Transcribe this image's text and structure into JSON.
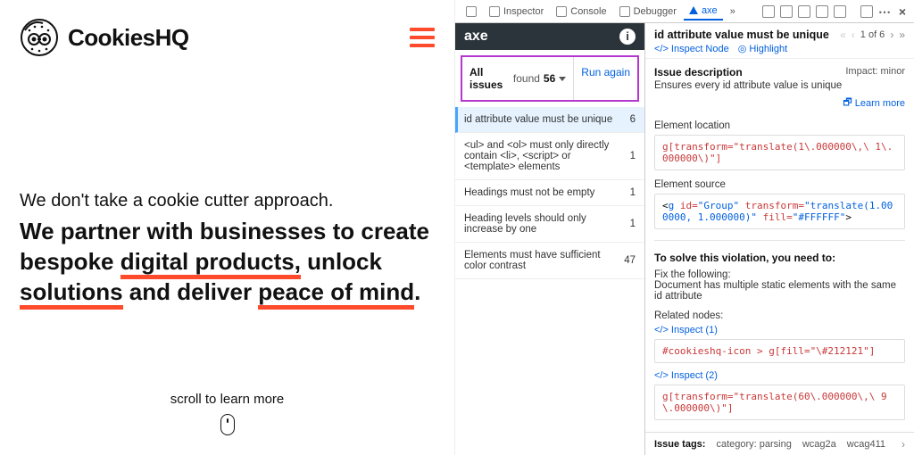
{
  "site": {
    "brand": "CookiesHQ",
    "hero_sub": "We don't take a cookie cutter approach.",
    "hero_line1_a": "We partner with businesses to create",
    "hero_line2_a": "bespoke ",
    "hero_u1": "digital products,",
    "hero_line2_b": " unlock",
    "hero_u2": "solutions",
    "hero_line3_b": " and deliver ",
    "hero_u3": "peace of mind",
    "hero_period": ".",
    "scroll": "scroll to learn more"
  },
  "devtools_tabs": {
    "inspector": "Inspector",
    "console": "Console",
    "debugger": "Debugger",
    "axe": "axe",
    "overflow": "»"
  },
  "axe": {
    "brand": "axe",
    "all_issues": "All issues",
    "found": " found ",
    "count": "56",
    "run_again": "Run again",
    "issues": [
      {
        "label": "id attribute value must be unique",
        "count": "6"
      },
      {
        "label": "<ul> and <ol> must only directly contain <li>, <script> or <template> elements",
        "count": "1"
      },
      {
        "label": "Headings must not be empty",
        "count": "1"
      },
      {
        "label": "Heading levels should only increase by one",
        "count": "1"
      },
      {
        "label": "Elements must have sufficient color contrast",
        "count": "47"
      }
    ]
  },
  "detail": {
    "title": "id attribute value must be unique",
    "inspect_node": "Inspect Node",
    "highlight": "Highlight",
    "pager": "1 of 6",
    "desc_h": "Issue description",
    "impact": "Impact: minor",
    "desc_t": "Ensures every id attribute value is unique",
    "learn": "Learn more",
    "elem_loc_h": "Element location",
    "elem_loc_code": "g[transform=\"translate(1\\.000000\\,\\ 1\\.000000\\)\"]",
    "elem_src_h": "Element source",
    "src_open": "<",
    "src_tag": "g",
    "src_attr_id": " id=",
    "src_val_id": "\"Group\"",
    "src_attr_tr": " transform=",
    "src_val_tr": "\"translate(1.000000, 1.000000)\"",
    "src_attr_fill": " fill=",
    "src_val_fill": "\"#FFFFFF\"",
    "src_close": ">",
    "solve_h": "To solve this violation, you need to:",
    "fix_h": "Fix the following:",
    "fix_t": "Document has multiple static elements with the same id attribute",
    "related_h": "Related nodes:",
    "insp1": "Inspect (1)",
    "rel1_code": "#cookieshq-icon > g[fill=\"\\#212121\"]",
    "insp2": "Inspect (2)",
    "rel2_code": "g[transform=\"translate(60\\.000000\\,\\ 9\\.000000\\)\"]",
    "tags_label": "Issue tags:",
    "tag1": "category: parsing",
    "tag2": "wcag2a",
    "tag3": "wcag411"
  }
}
